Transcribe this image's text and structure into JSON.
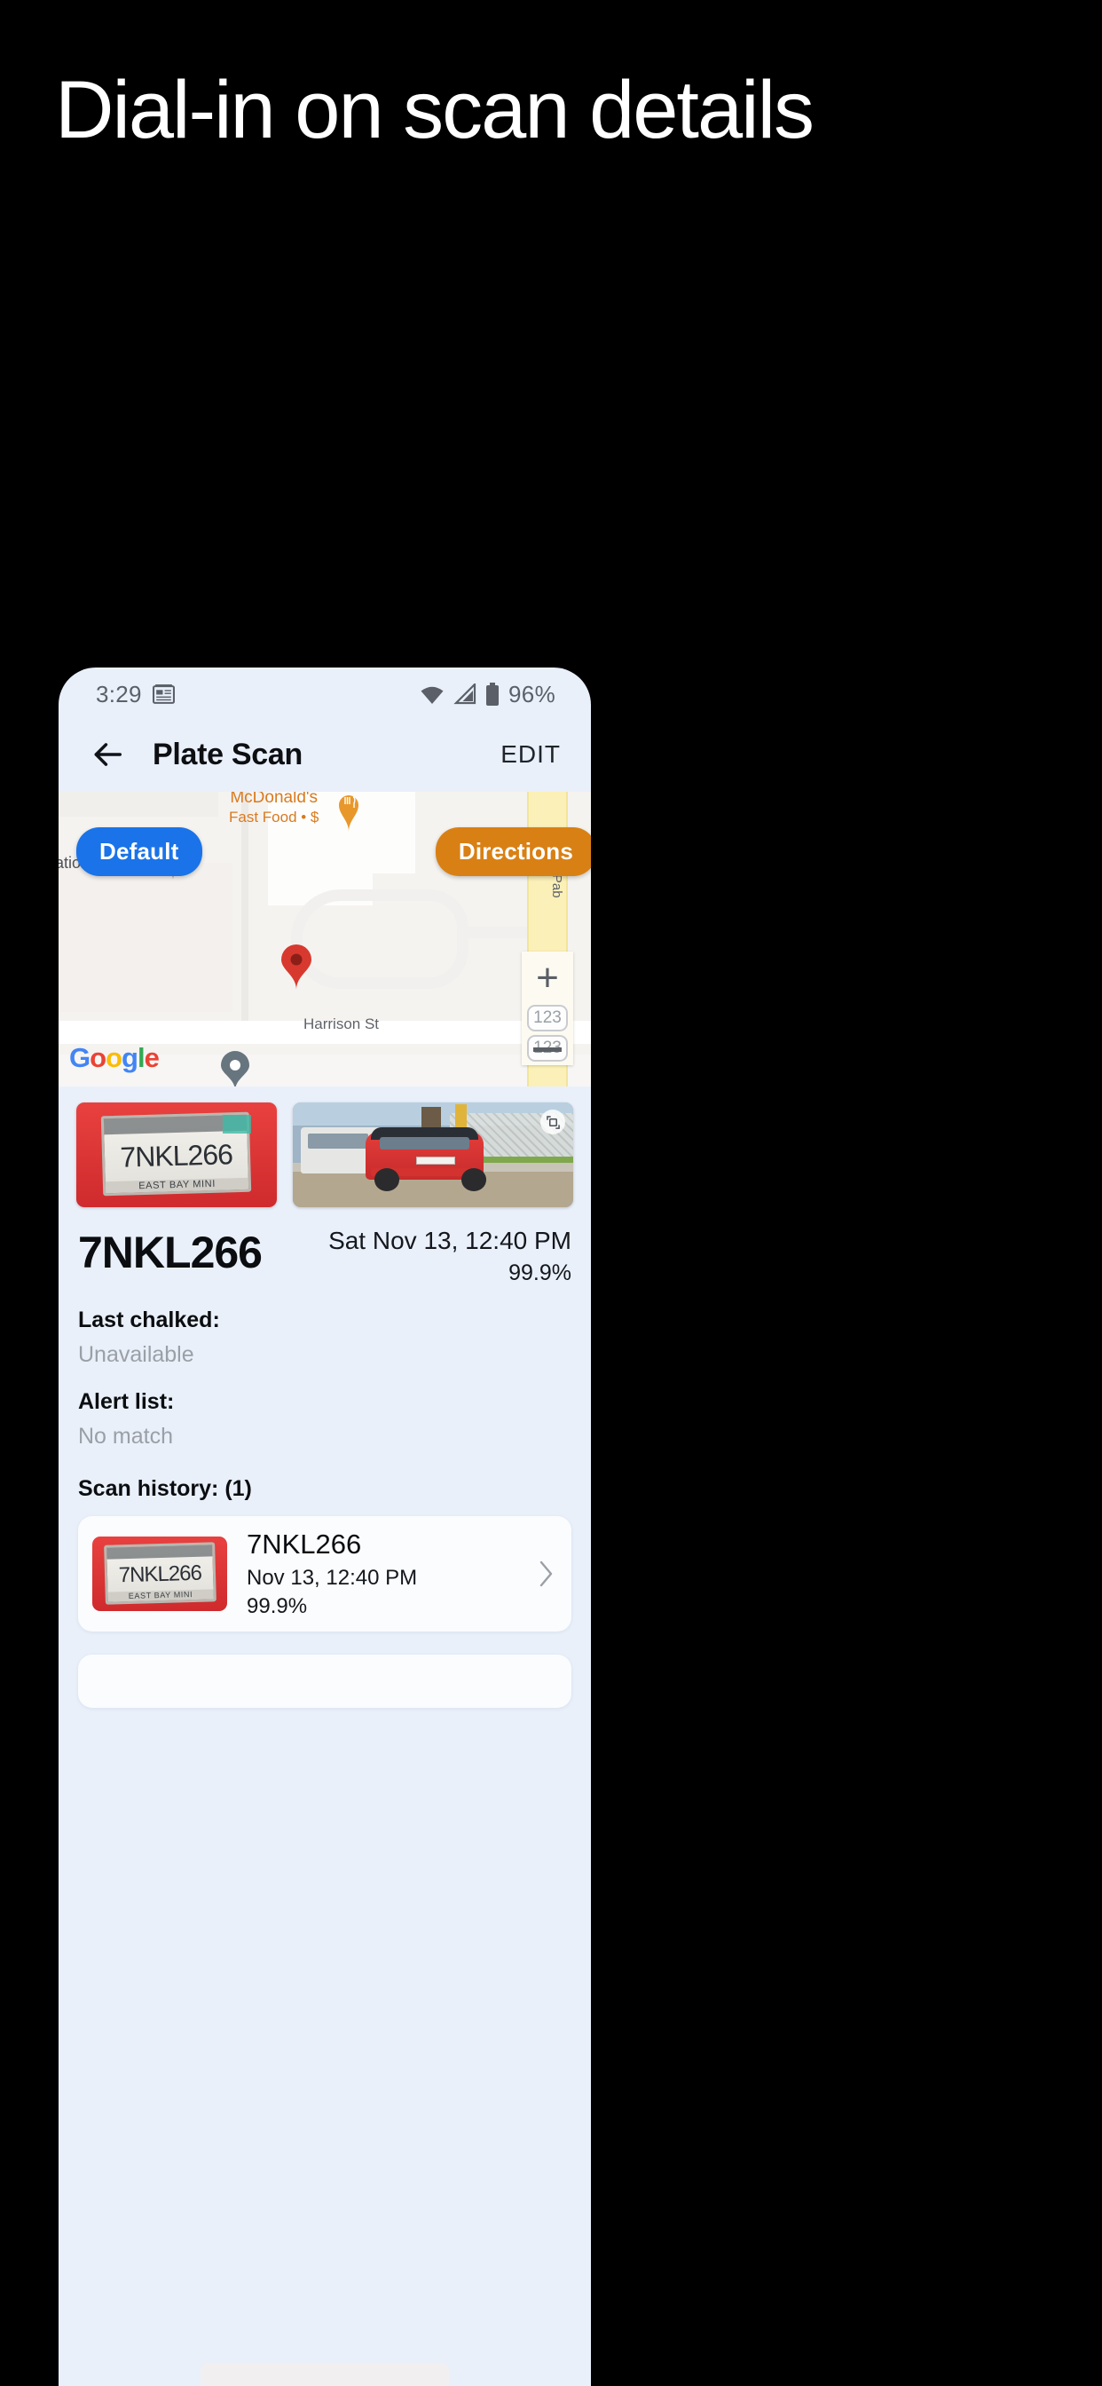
{
  "headline": "Dial-in on scan details",
  "phone": {
    "status_bar": {
      "time": "3:29",
      "news_icon": "news-feed-icon",
      "wifi_icon": "wifi-icon",
      "signal_icon": "cellular-signal-icon",
      "battery_icon": "battery-icon",
      "battery_percent": "96%"
    },
    "app_bar": {
      "back_icon": "back-arrow-icon",
      "title": "Plate Scan",
      "edit_label": "EDIT"
    },
    "map": {
      "default_button": "Default",
      "directions_button": "Directions",
      "poi_name": "McDonald's",
      "poi_sub": "Fast Food • $",
      "street_vertical": "San Pab",
      "street_horizontal": "Harrison St",
      "partial_label_left": "ational",
      "attribution": "Google",
      "zoom_in": "+",
      "route_shield_a": "123",
      "route_shield_b": "123",
      "marker_primary": "location-pin-red",
      "marker_secondary": "location-pin-gray"
    },
    "scan": {
      "plate_number": "7NKL266",
      "plate_frame_text": "EAST BAY MINI",
      "timestamp": "Sat Nov 13, 12:40 PM",
      "confidence": "99.9%",
      "expand_icon": "expand-photo-icon",
      "fields": [
        {
          "label": "Last chalked:",
          "value": "Unavailable"
        },
        {
          "label": "Alert list:",
          "value": "No match"
        }
      ],
      "history_heading": "Scan history: (1)",
      "history": [
        {
          "plate": "7NKL266",
          "date": "Nov 13, 12:40 PM",
          "confidence": "99.9%",
          "chevron": "chevron-right-icon"
        }
      ]
    }
  },
  "colors": {
    "page_background": "#000000",
    "phone_background": "#e9f0fa",
    "default_button": "#1a73e8",
    "directions_button": "#d98014",
    "marker_red": "#d93025",
    "marker_gray": "#67757f",
    "muted_text": "#9aa0a6"
  }
}
